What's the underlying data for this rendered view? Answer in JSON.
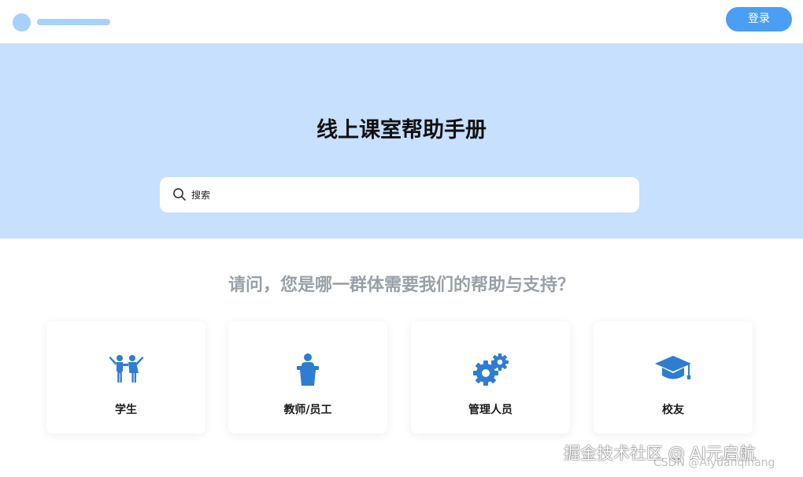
{
  "header": {
    "login_label": "登录"
  },
  "hero": {
    "title": "线上课室帮助手册",
    "search": {
      "placeholder": "搜索",
      "value": ""
    }
  },
  "question": "请问，您是哪一群体需要我们的帮助与支持？",
  "cards": [
    {
      "label": "学生",
      "icon": "students-icon"
    },
    {
      "label": "教师/员工",
      "icon": "lectern-speaker-icon"
    },
    {
      "label": "管理人员",
      "icon": "gears-icon"
    },
    {
      "label": "校友",
      "icon": "graduation-cap-icon"
    }
  ],
  "colors": {
    "accent": "#4a9ef4",
    "hero_bg": "#c6e0fd",
    "logo": "#a7d0fb",
    "icon": "#2e7dd1"
  },
  "watermark": {
    "main": "掘金技术社区 @ AI元启航",
    "sub": "CSDN @Aiyuanqihang"
  }
}
